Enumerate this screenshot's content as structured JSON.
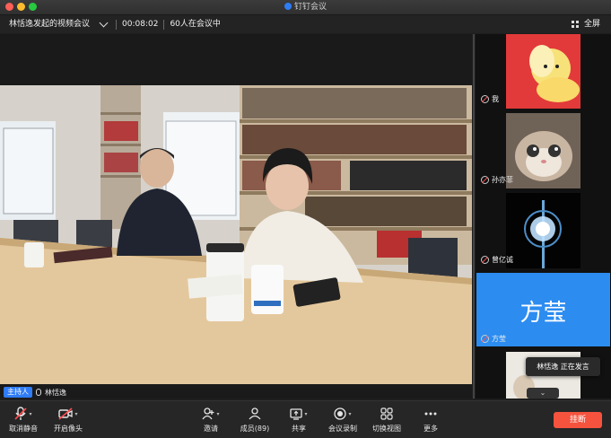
{
  "window": {
    "title": "钉钉会议"
  },
  "meeting": {
    "title": "林恬逸发起的视频会议",
    "duration": "00:08:02",
    "participants_status": "60人在会议中",
    "fullscreen_label": "全屏"
  },
  "stage": {
    "host_badge": "主持人",
    "host_name": "林恬逸"
  },
  "participants": [
    {
      "name": "我"
    },
    {
      "name": "孙亦菲"
    },
    {
      "name": "曾亿诚"
    },
    {
      "name": "方莹",
      "avatar_text": "方莹"
    }
  ],
  "speaking_toast": "林恬逸  正在发言",
  "toolbar": {
    "unmute": "取消静音",
    "camera": "开启像头",
    "invite": "邀请",
    "members": "成员(89)",
    "share": "共享",
    "record": "会议录制",
    "switch_view": "切换视图",
    "more": "更多",
    "hangup": "挂断"
  },
  "colors": {
    "accent": "#2f7cf6",
    "hangup": "#f5533e",
    "avatar_blue": "#2c8cf0"
  }
}
